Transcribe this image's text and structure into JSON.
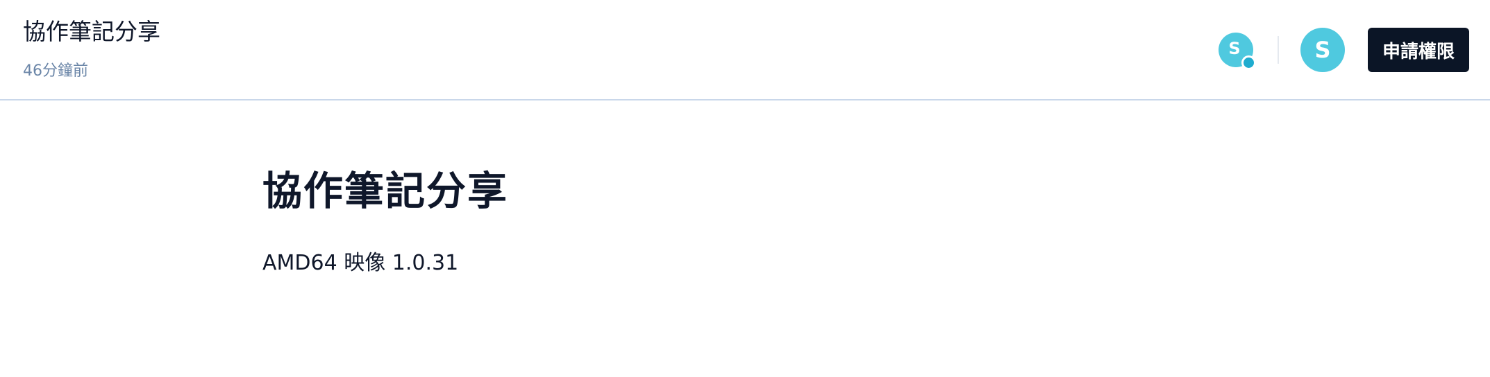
{
  "header": {
    "title": "協作筆記分享",
    "updated": "46分鐘前",
    "presence_initial": "S",
    "avatar_initial": "S",
    "request_button_label": "申請權限"
  },
  "content": {
    "heading": "協作筆記分享",
    "paragraph": "AMD64 映像 1.0.31"
  },
  "colors": {
    "avatar": "#4fc9df",
    "presence_dot": "#1faccf",
    "button_bg": "#0b1526",
    "muted_text": "#6b86a8",
    "header_border": "#c9d7ea"
  }
}
